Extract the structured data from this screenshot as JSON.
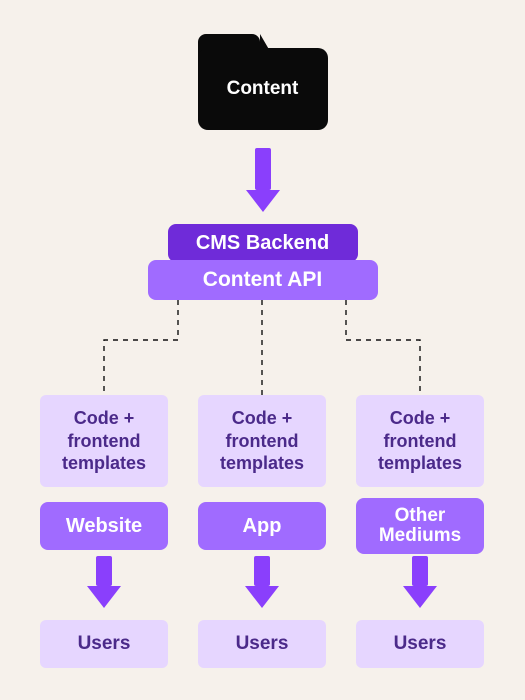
{
  "source": {
    "label": "Content"
  },
  "backend": {
    "label": "CMS Backend"
  },
  "api": {
    "label": "Content API"
  },
  "columns": [
    {
      "templates": "Code + frontend templates",
      "medium": "Website",
      "users": "Users"
    },
    {
      "templates": "Code + frontend templates",
      "medium": "App",
      "users": "Users"
    },
    {
      "templates": "Code + frontend templates",
      "medium": "Other Mediums",
      "users": "Users"
    }
  ],
  "colors": {
    "bg": "#f6f1eb",
    "folder": "#0a0a0a",
    "arrow": "#8a3ffc",
    "pill_dark": "#6f2bd9",
    "pill_light": "#a06bff",
    "box_bg": "#e6d6ff",
    "box_text": "#4b2a8a"
  }
}
